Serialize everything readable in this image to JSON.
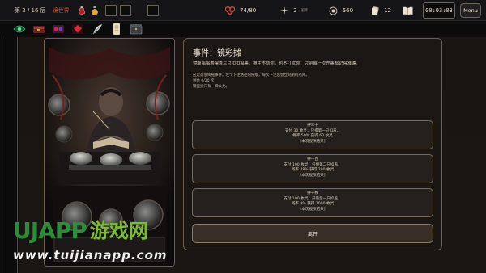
{
  "topbar": {
    "floor": "第 2 / 16 层",
    "world": "镜世界",
    "hp": "74/80",
    "cards": "2",
    "cards_sub": "张牌",
    "gold": "560",
    "deck": "12",
    "timer": "00:03:03",
    "menu": "Menu"
  },
  "relics": [
    "green-eye-relic",
    "crimson-tome-relic",
    "ruby-chest-relic",
    "red-gem-relic",
    "silver-feather-relic",
    "scroll-relic",
    "dark-casket-relic"
  ],
  "event": {
    "title": "事件：镜彩摊",
    "desc": "镜面嗡嗡着摆着三只扣扣揭盖。摊主不动你，也不打扰你，只把每一次开盖都记得准确。",
    "note1": "这是高低揭秘事件。左个下注路径均按顺，每次下注后会立刻刷码点降。",
    "note2": "剩余 0/20 次",
    "note3": "镜面折只有一瞬公允。",
    "options": [
      {
        "name": "押三十",
        "l1": "支付 30 枚灵，只揭第一只扣盖。",
        "l2": "概率 50% 获得 60 枚灵",
        "l3": "[本次视项结果]"
      },
      {
        "name": "押一百",
        "l1": "支付 100 枚灵，只揭第二只扣盖。",
        "l2": "概率 48% 获得 200 枚灵",
        "l3": "[本次视项结果]"
      },
      {
        "name": "押千枚",
        "l1": "支付 100 枚灵，开最后一只扣盖。",
        "l2": "概率 9% 获得 1000 枚灵",
        "l3": "[本次视项结果]"
      }
    ],
    "leave": "离开"
  },
  "watermark": {
    "logo": "UJAPP",
    "cn": "游戏网",
    "url": "www.tuijianapp.com"
  },
  "colors": {
    "accent_red": "#d64a3a",
    "panel_border": "#6c5d4a",
    "watermark_green": "#2f8b3c"
  }
}
